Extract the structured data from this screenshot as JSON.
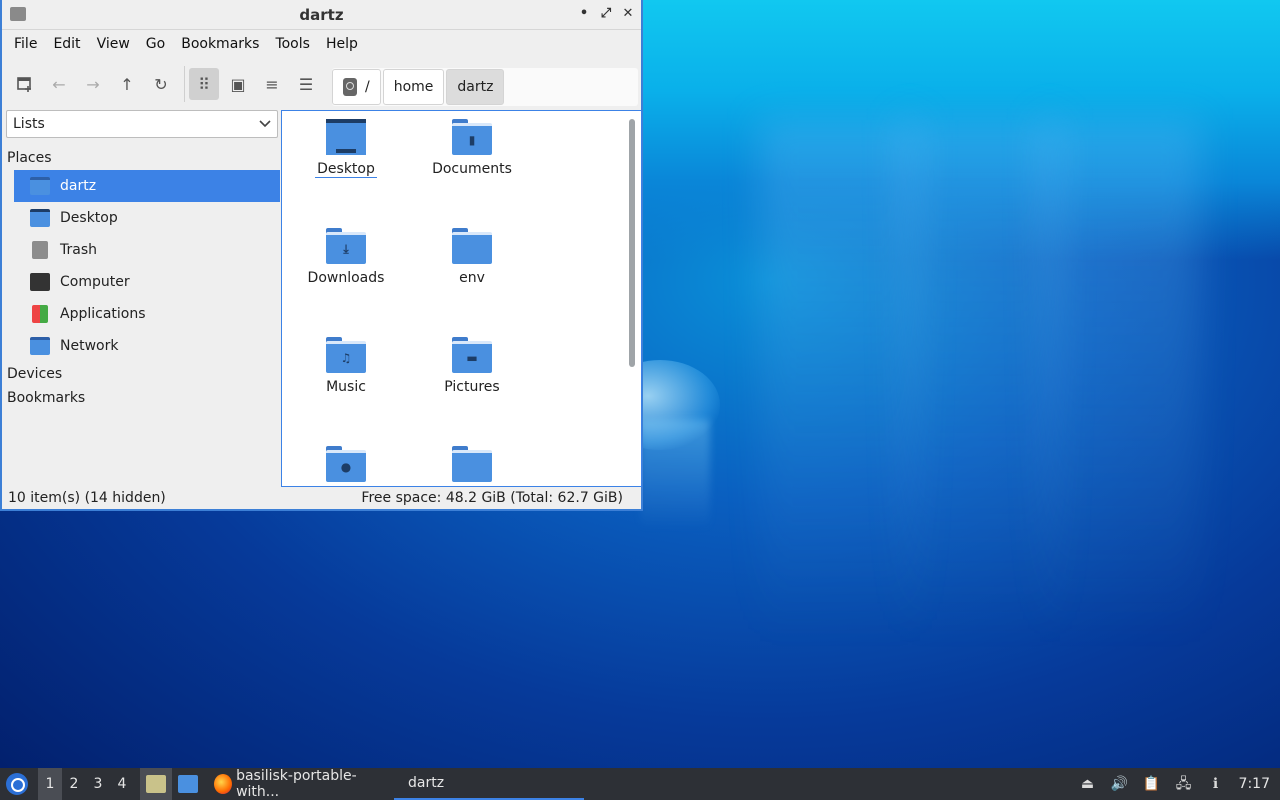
{
  "window": {
    "title": "dartz",
    "controls": {
      "minimize": "•",
      "maximize": "⤢",
      "close": "✕"
    }
  },
  "menubar": [
    "File",
    "Edit",
    "View",
    "Go",
    "Bookmarks",
    "Tools",
    "Help"
  ],
  "toolbar": {
    "new_window_icon": "new-window-icon",
    "back_icon": "←",
    "forward_icon": "→",
    "up_icon": "↑",
    "reload_icon": "↻",
    "icon_view_icon": "⠿",
    "thumbnail_view_icon": "▣",
    "compact_view_icon": "≡",
    "list_view_icon": "☰"
  },
  "pathbar": {
    "root": "/",
    "crumbs": [
      "home",
      "dartz"
    ]
  },
  "sidepane": {
    "mode": "Lists",
    "sections": {
      "places": "Places",
      "devices": "Devices",
      "bookmarks": "Bookmarks"
    },
    "places": [
      {
        "label": "dartz",
        "icon": "home-folder-icon",
        "selected": true
      },
      {
        "label": "Desktop",
        "icon": "desktop-icon"
      },
      {
        "label": "Trash",
        "icon": "trash-icon"
      },
      {
        "label": "Computer",
        "icon": "computer-icon"
      },
      {
        "label": "Applications",
        "icon": "applications-icon"
      },
      {
        "label": "Network",
        "icon": "network-icon"
      }
    ]
  },
  "files": [
    {
      "label": "Desktop",
      "icon": "desktop-folder-icon",
      "glyph": ""
    },
    {
      "label": "Documents",
      "icon": "documents-folder-icon",
      "glyph": "▮"
    },
    {
      "label": "Downloads",
      "icon": "downloads-folder-icon",
      "glyph": "⤓"
    },
    {
      "label": "env",
      "icon": "folder-icon",
      "glyph": ""
    },
    {
      "label": "Music",
      "icon": "music-folder-icon",
      "glyph": "♫"
    },
    {
      "label": "Pictures",
      "icon": "pictures-folder-icon",
      "glyph": "▬"
    },
    {
      "label": "",
      "icon": "public-folder-icon",
      "glyph": "●"
    },
    {
      "label": "",
      "icon": "folder-icon",
      "glyph": ""
    }
  ],
  "statusbar": {
    "count": "10 item(s) (14 hidden)",
    "free_space": "Free space: 48.2 GiB (Total: 62.7 GiB)"
  },
  "taskbar": {
    "desktops": [
      "1",
      "2",
      "3",
      "4"
    ],
    "tasks": [
      {
        "label": "basilisk-portable-with...",
        "icon": "firefox-icon"
      },
      {
        "label": "dartz",
        "icon": "folder-icon"
      }
    ],
    "clock": "7:17"
  },
  "colors": {
    "accent": "#3c82e6",
    "folder": "#4a90e0",
    "taskbar": "#2d3036"
  }
}
